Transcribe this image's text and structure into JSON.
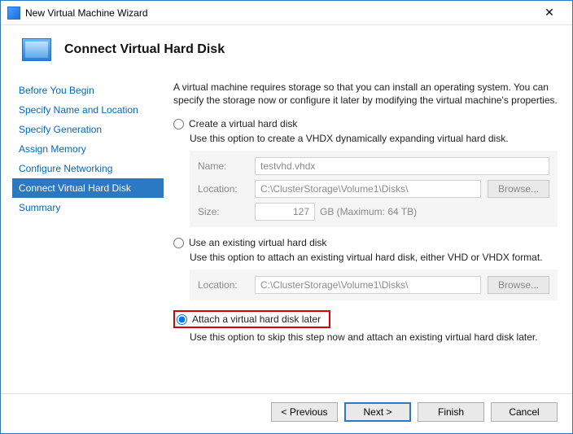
{
  "window": {
    "title": "New Virtual Machine Wizard"
  },
  "header": {
    "title": "Connect Virtual Hard Disk"
  },
  "nav": {
    "items": [
      "Before You Begin",
      "Specify Name and Location",
      "Specify Generation",
      "Assign Memory",
      "Configure Networking",
      "Connect Virtual Hard Disk",
      "Summary"
    ],
    "active_index": 5
  },
  "content": {
    "intro": "A virtual machine requires storage so that you can install an operating system. You can specify the storage now or configure it later by modifying the virtual machine's properties."
  },
  "options": {
    "create": {
      "label": "Create a virtual hard disk",
      "desc": "Use this option to create a VHDX dynamically expanding virtual hard disk.",
      "selected": false,
      "fields": {
        "name_label": "Name:",
        "name_value": "testvhd.vhdx",
        "location_label": "Location:",
        "location_value": "C:\\ClusterStorage\\Volume1\\Disks\\",
        "browse": "Browse...",
        "size_label": "Size:",
        "size_value": "127",
        "size_max": "GB (Maximum: 64 TB)"
      }
    },
    "existing": {
      "label": "Use an existing virtual hard disk",
      "desc": "Use this option to attach an existing virtual hard disk, either VHD or VHDX format.",
      "selected": false,
      "fields": {
        "location_label": "Location:",
        "location_value": "C:\\ClusterStorage\\Volume1\\Disks\\",
        "browse": "Browse..."
      }
    },
    "later": {
      "label": "Attach a virtual hard disk later",
      "desc": "Use this option to skip this step now and attach an existing virtual hard disk later.",
      "selected": true
    }
  },
  "footer": {
    "previous": "< Previous",
    "next": "Next >",
    "finish": "Finish",
    "cancel": "Cancel"
  }
}
